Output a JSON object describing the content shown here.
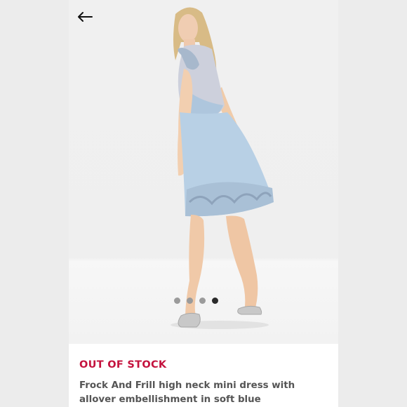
{
  "nav": {
    "back_icon": "arrow-left-icon"
  },
  "gallery": {
    "dot_count": 4,
    "active_index": 3,
    "image_subject": "woman wearing a soft blue embellished mini dress with silver heels"
  },
  "product": {
    "status": "OUT OF STOCK",
    "title": "Frock And Frill high neck mini dress with allover embellishment in soft blue"
  },
  "colors": {
    "status": "#c4133e",
    "title": "#555555",
    "background": "#ececec",
    "dress": "#b9d2e6"
  }
}
